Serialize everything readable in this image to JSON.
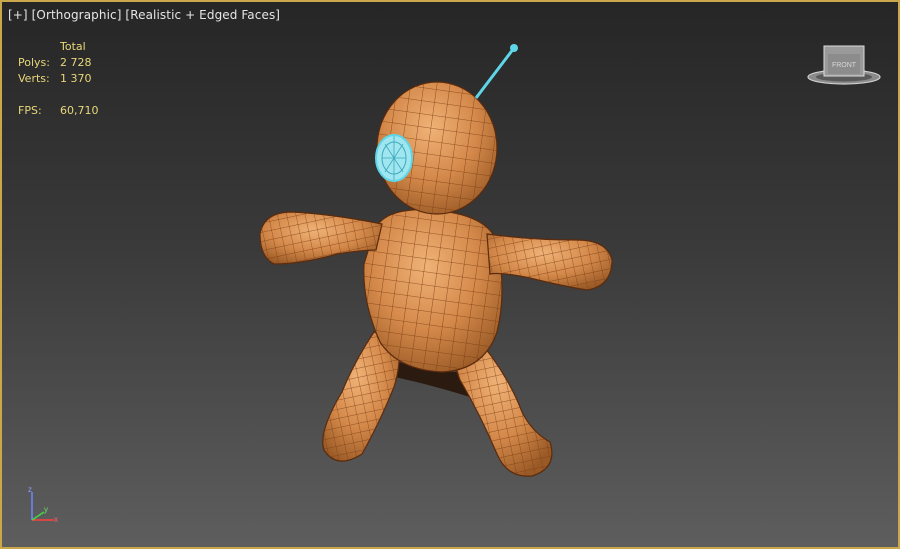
{
  "viewport": {
    "label_plus": "[+]",
    "label_view": "[Orthographic]",
    "label_shading": "[Realistic + Edged Faces]"
  },
  "stats": {
    "header": "Total",
    "polys_label": "Polys:",
    "polys_value": "2 728",
    "verts_label": "Verts:",
    "verts_value": "1 370",
    "fps_label": "FPS:",
    "fps_value": "60,710"
  },
  "viewcube": {
    "face_label": "FRONT",
    "icon": "viewcube-icon"
  },
  "axis": {
    "x": "x",
    "y": "y",
    "z": "z"
  },
  "colors": {
    "border": "#c9a74a",
    "stats_text": "#e8d77a",
    "mesh_fill": "#d08a4a",
    "mesh_edges": "#7a3c12",
    "selection": "#5fd6e8"
  }
}
